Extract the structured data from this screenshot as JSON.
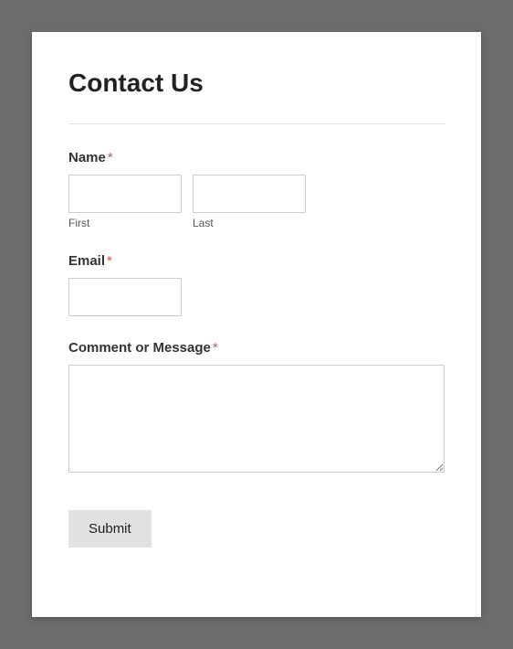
{
  "title": "Contact Us",
  "required_marker": "*",
  "fields": {
    "name": {
      "label": "Name",
      "first_sublabel": "First",
      "last_sublabel": "Last",
      "first_value": "",
      "last_value": ""
    },
    "email": {
      "label": "Email",
      "value": ""
    },
    "message": {
      "label": "Comment or Message",
      "value": ""
    }
  },
  "submit_label": "Submit"
}
